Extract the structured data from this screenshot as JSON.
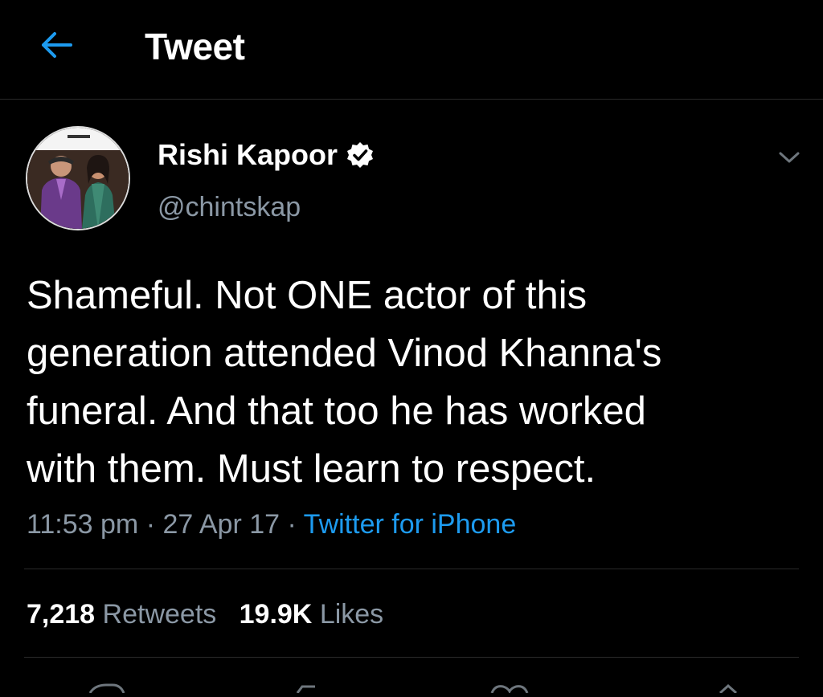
{
  "header": {
    "title": "Tweet",
    "back_icon": "arrow-left-icon",
    "accent_color": "#1d9bf0"
  },
  "tweet": {
    "author": {
      "display_name": "Rishi Kapoor",
      "handle": "@chintskap",
      "verified": true,
      "verified_icon": "verified-badge-icon"
    },
    "more_icon": "chevron-down-icon",
    "text": "Shameful. Not ONE actor of this\ngeneration attended Vinod Khanna's\nfuneral. And that too he has worked\nwith them. Must learn to respect.",
    "time": "11:53 pm",
    "date": "27 Apr 17",
    "source": "Twitter for iPhone",
    "separator": "·"
  },
  "stats": {
    "retweets_count": "7,218",
    "retweets_label": "Retweets",
    "likes_count": "19.9K",
    "likes_label": "Likes"
  },
  "colors": {
    "background": "#000000",
    "text": "#ffffff",
    "secondary": "#8b98a5",
    "link": "#1d9bf0",
    "divider": "#2a2a2a"
  }
}
